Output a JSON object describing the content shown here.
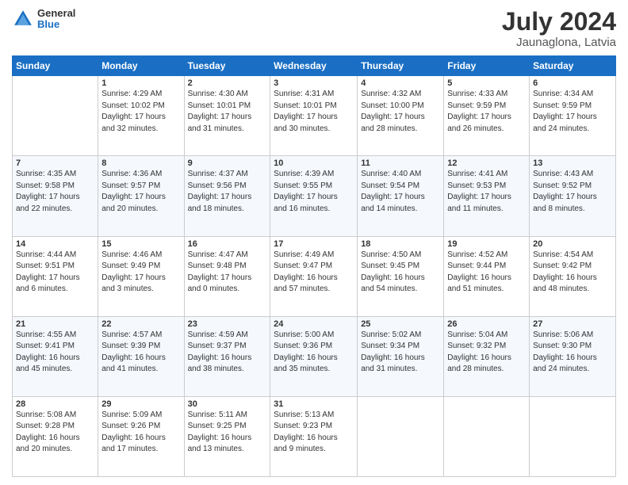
{
  "header": {
    "logo": {
      "line1": "General",
      "line2": "Blue"
    },
    "title": "July 2024",
    "subtitle": "Jaunaglona, Latvia"
  },
  "calendar": {
    "days_of_week": [
      "Sunday",
      "Monday",
      "Tuesday",
      "Wednesday",
      "Thursday",
      "Friday",
      "Saturday"
    ],
    "weeks": [
      [
        {
          "day": "",
          "info": ""
        },
        {
          "day": "1",
          "info": "Sunrise: 4:29 AM\nSunset: 10:02 PM\nDaylight: 17 hours\nand 32 minutes."
        },
        {
          "day": "2",
          "info": "Sunrise: 4:30 AM\nSunset: 10:01 PM\nDaylight: 17 hours\nand 31 minutes."
        },
        {
          "day": "3",
          "info": "Sunrise: 4:31 AM\nSunset: 10:01 PM\nDaylight: 17 hours\nand 30 minutes."
        },
        {
          "day": "4",
          "info": "Sunrise: 4:32 AM\nSunset: 10:00 PM\nDaylight: 17 hours\nand 28 minutes."
        },
        {
          "day": "5",
          "info": "Sunrise: 4:33 AM\nSunset: 9:59 PM\nDaylight: 17 hours\nand 26 minutes."
        },
        {
          "day": "6",
          "info": "Sunrise: 4:34 AM\nSunset: 9:59 PM\nDaylight: 17 hours\nand 24 minutes."
        }
      ],
      [
        {
          "day": "7",
          "info": "Sunrise: 4:35 AM\nSunset: 9:58 PM\nDaylight: 17 hours\nand 22 minutes."
        },
        {
          "day": "8",
          "info": "Sunrise: 4:36 AM\nSunset: 9:57 PM\nDaylight: 17 hours\nand 20 minutes."
        },
        {
          "day": "9",
          "info": "Sunrise: 4:37 AM\nSunset: 9:56 PM\nDaylight: 17 hours\nand 18 minutes."
        },
        {
          "day": "10",
          "info": "Sunrise: 4:39 AM\nSunset: 9:55 PM\nDaylight: 17 hours\nand 16 minutes."
        },
        {
          "day": "11",
          "info": "Sunrise: 4:40 AM\nSunset: 9:54 PM\nDaylight: 17 hours\nand 14 minutes."
        },
        {
          "day": "12",
          "info": "Sunrise: 4:41 AM\nSunset: 9:53 PM\nDaylight: 17 hours\nand 11 minutes."
        },
        {
          "day": "13",
          "info": "Sunrise: 4:43 AM\nSunset: 9:52 PM\nDaylight: 17 hours\nand 8 minutes."
        }
      ],
      [
        {
          "day": "14",
          "info": "Sunrise: 4:44 AM\nSunset: 9:51 PM\nDaylight: 17 hours\nand 6 minutes."
        },
        {
          "day": "15",
          "info": "Sunrise: 4:46 AM\nSunset: 9:49 PM\nDaylight: 17 hours\nand 3 minutes."
        },
        {
          "day": "16",
          "info": "Sunrise: 4:47 AM\nSunset: 9:48 PM\nDaylight: 17 hours\nand 0 minutes."
        },
        {
          "day": "17",
          "info": "Sunrise: 4:49 AM\nSunset: 9:47 PM\nDaylight: 16 hours\nand 57 minutes."
        },
        {
          "day": "18",
          "info": "Sunrise: 4:50 AM\nSunset: 9:45 PM\nDaylight: 16 hours\nand 54 minutes."
        },
        {
          "day": "19",
          "info": "Sunrise: 4:52 AM\nSunset: 9:44 PM\nDaylight: 16 hours\nand 51 minutes."
        },
        {
          "day": "20",
          "info": "Sunrise: 4:54 AM\nSunset: 9:42 PM\nDaylight: 16 hours\nand 48 minutes."
        }
      ],
      [
        {
          "day": "21",
          "info": "Sunrise: 4:55 AM\nSunset: 9:41 PM\nDaylight: 16 hours\nand 45 minutes."
        },
        {
          "day": "22",
          "info": "Sunrise: 4:57 AM\nSunset: 9:39 PM\nDaylight: 16 hours\nand 41 minutes."
        },
        {
          "day": "23",
          "info": "Sunrise: 4:59 AM\nSunset: 9:37 PM\nDaylight: 16 hours\nand 38 minutes."
        },
        {
          "day": "24",
          "info": "Sunrise: 5:00 AM\nSunset: 9:36 PM\nDaylight: 16 hours\nand 35 minutes."
        },
        {
          "day": "25",
          "info": "Sunrise: 5:02 AM\nSunset: 9:34 PM\nDaylight: 16 hours\nand 31 minutes."
        },
        {
          "day": "26",
          "info": "Sunrise: 5:04 AM\nSunset: 9:32 PM\nDaylight: 16 hours\nand 28 minutes."
        },
        {
          "day": "27",
          "info": "Sunrise: 5:06 AM\nSunset: 9:30 PM\nDaylight: 16 hours\nand 24 minutes."
        }
      ],
      [
        {
          "day": "28",
          "info": "Sunrise: 5:08 AM\nSunset: 9:28 PM\nDaylight: 16 hours\nand 20 minutes."
        },
        {
          "day": "29",
          "info": "Sunrise: 5:09 AM\nSunset: 9:26 PM\nDaylight: 16 hours\nand 17 minutes."
        },
        {
          "day": "30",
          "info": "Sunrise: 5:11 AM\nSunset: 9:25 PM\nDaylight: 16 hours\nand 13 minutes."
        },
        {
          "day": "31",
          "info": "Sunrise: 5:13 AM\nSunset: 9:23 PM\nDaylight: 16 hours\nand 9 minutes."
        },
        {
          "day": "",
          "info": ""
        },
        {
          "day": "",
          "info": ""
        },
        {
          "day": "",
          "info": ""
        }
      ]
    ]
  }
}
